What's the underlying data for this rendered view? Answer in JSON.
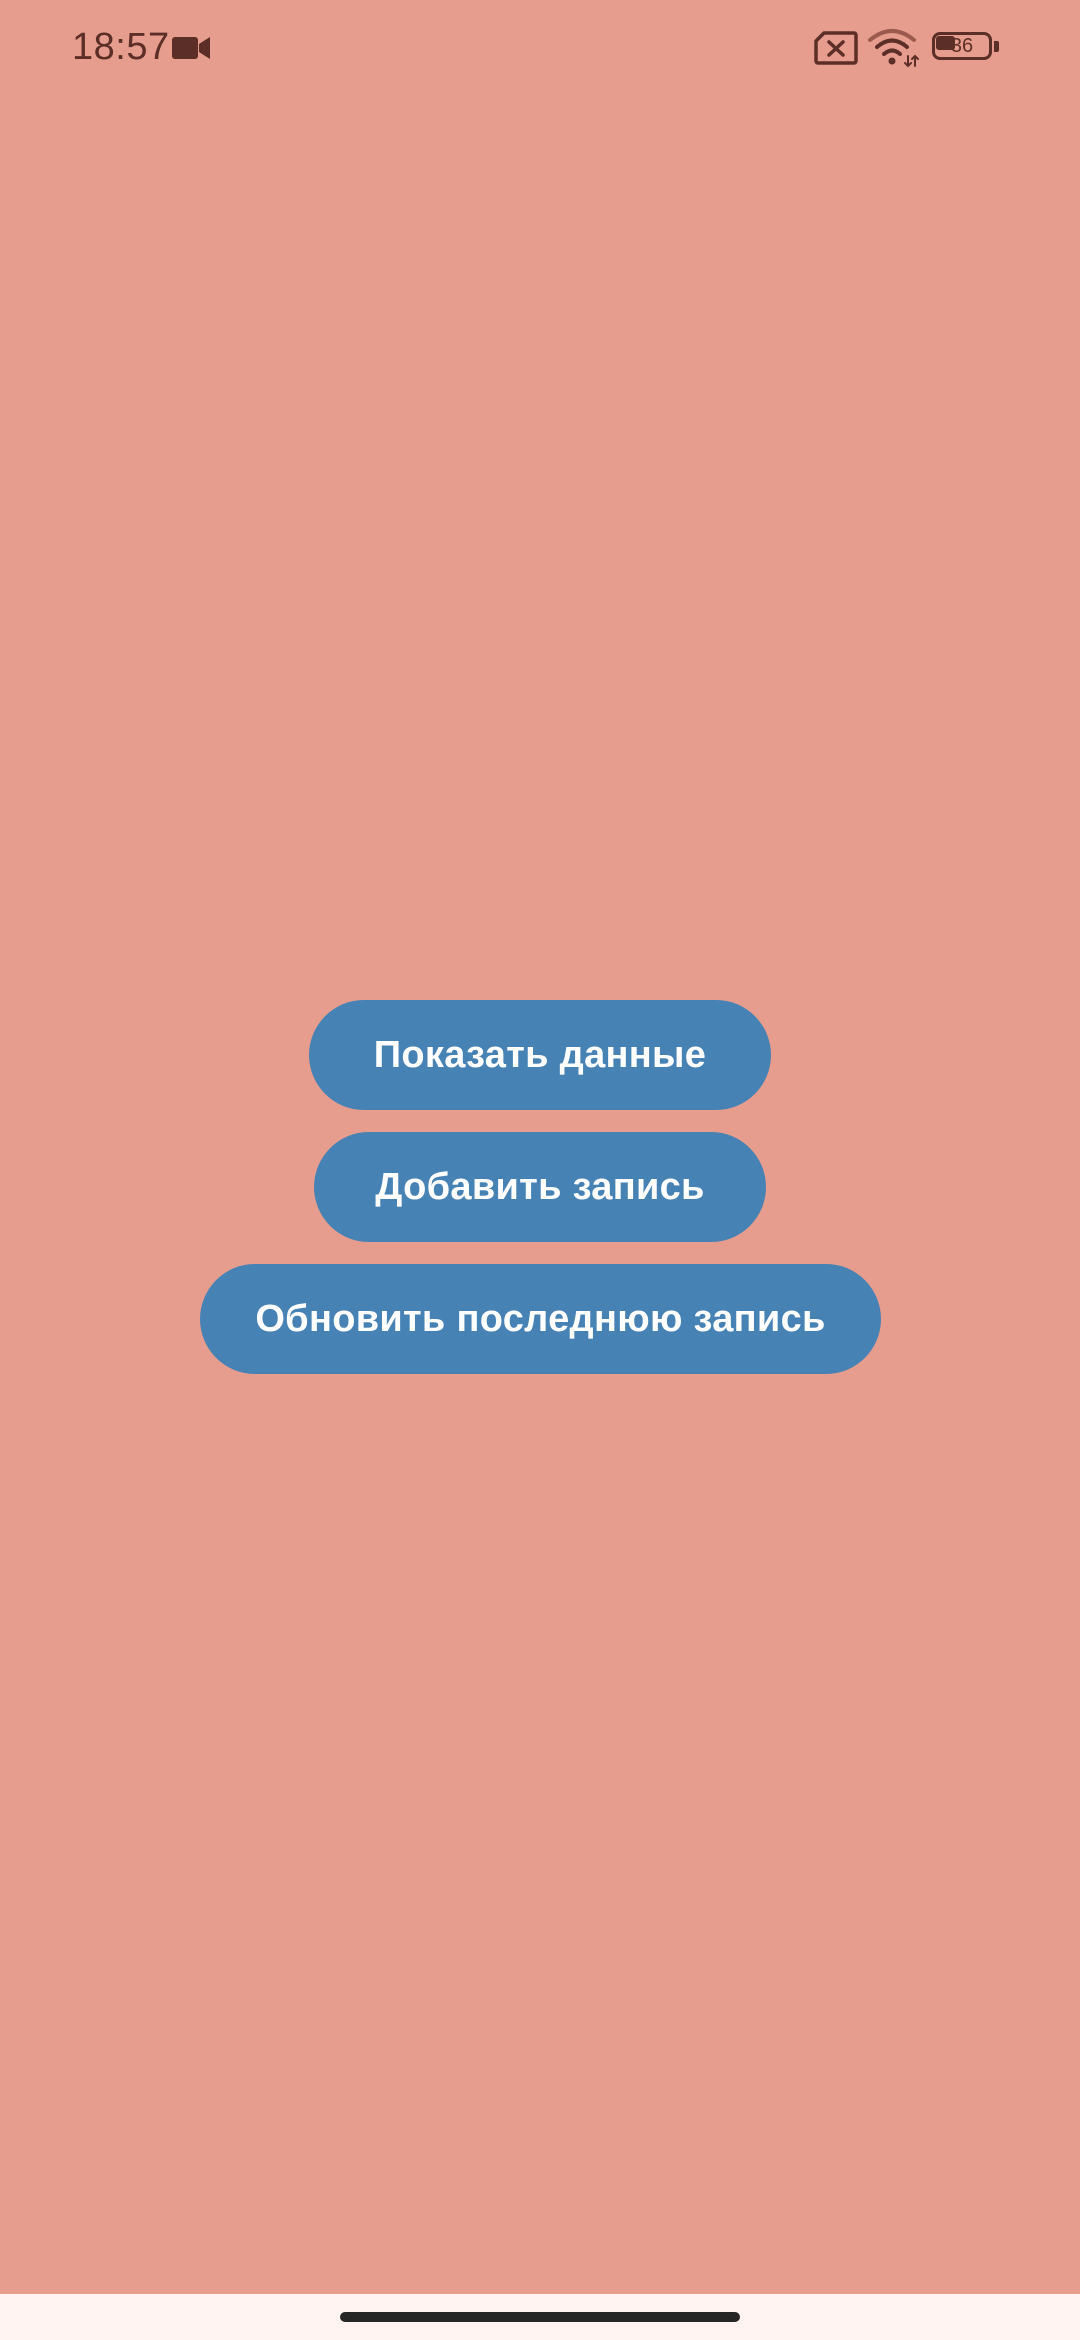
{
  "status_bar": {
    "time": "18:57",
    "battery_percent": 36,
    "battery_label": "36",
    "icons": [
      "video-camera-icon",
      "no-sim-icon",
      "wifi-icon",
      "battery-icon"
    ]
  },
  "buttons": {
    "show_data": "Показать данные",
    "add_record": "Добавить запись",
    "update_last_record": "Обновить последнюю запись"
  },
  "colors": {
    "background": "#e69d8d",
    "button": "#4682b4",
    "button_text": "#ffffff",
    "status_icons": "#5b2e27"
  }
}
